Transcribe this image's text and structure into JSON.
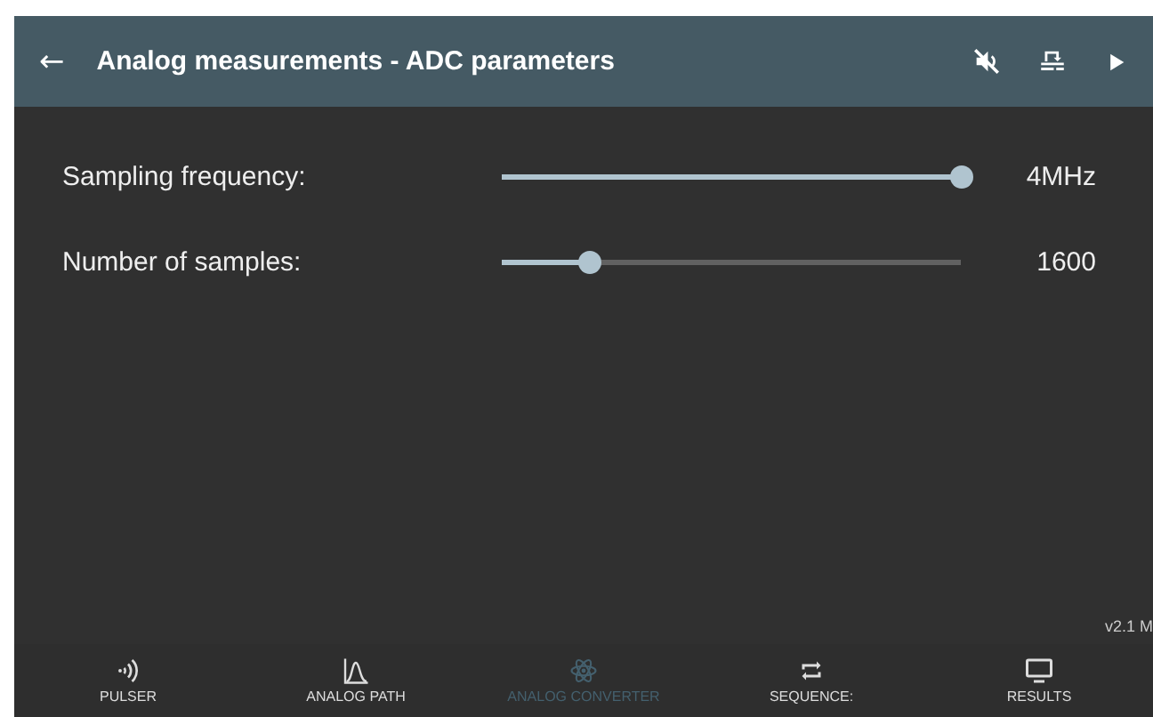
{
  "header": {
    "back": "←",
    "title": "Analog measurements - ADC parameters"
  },
  "settings": [
    {
      "label": "Sampling frequency:",
      "level": 1.0,
      "reading": "4MHz"
    },
    {
      "label": "Number of samples:",
      "level": 0.19,
      "reading": "1600"
    }
  ],
  "version": "v2.1 M",
  "nav": [
    {
      "kind": "pulser",
      "label": "PULSER",
      "selected": false
    },
    {
      "kind": "analog",
      "label": "ANALOG PATH",
      "selected": false
    },
    {
      "kind": "converter",
      "label": "ANALOG CONVERTER",
      "selected": true
    },
    {
      "kind": "sequence",
      "label": "SEQUENCE:",
      "selected": false
    },
    {
      "kind": "results",
      "label": "RESULTS",
      "selected": false
    }
  ]
}
